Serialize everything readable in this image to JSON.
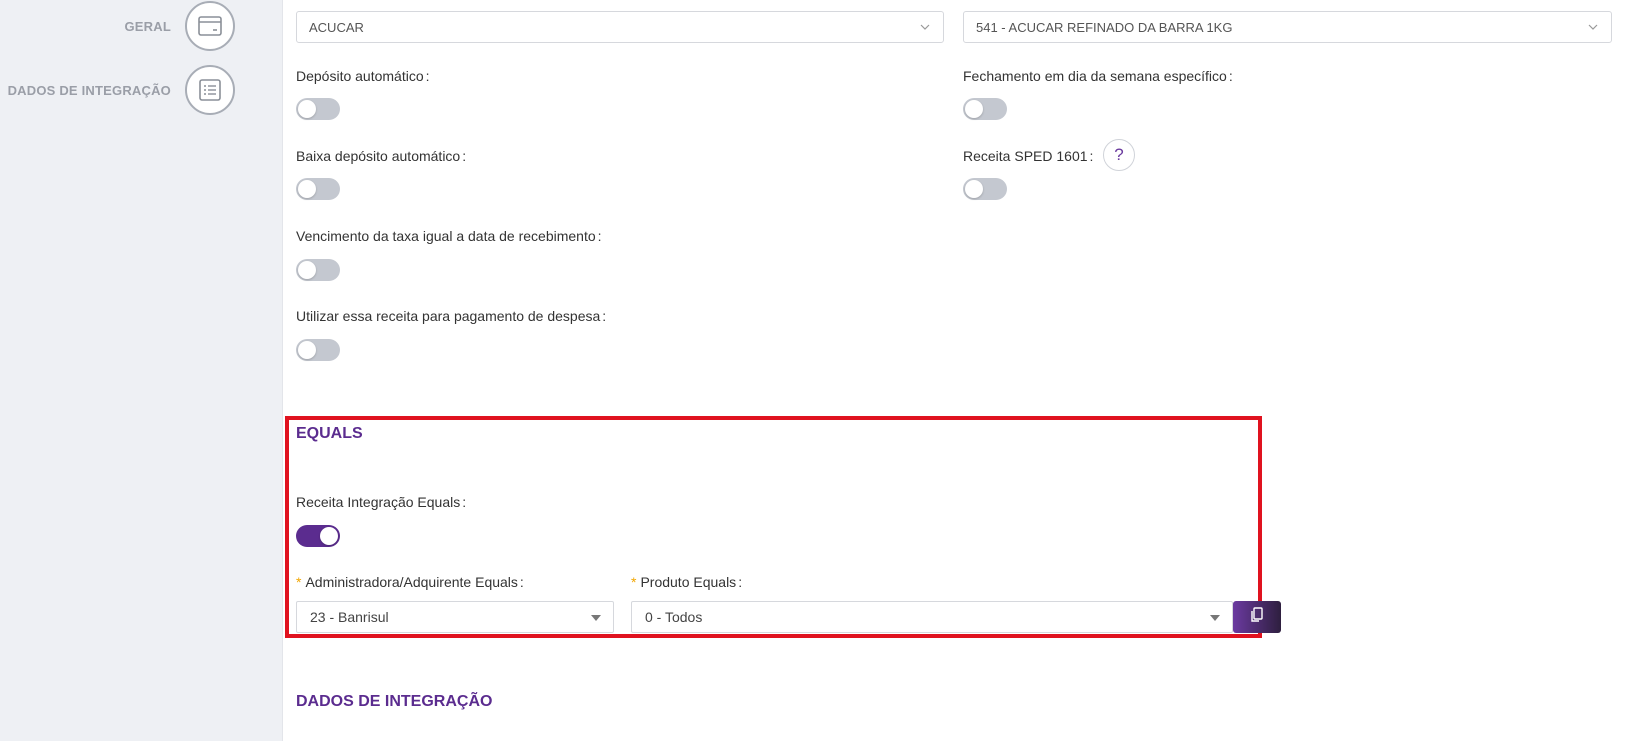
{
  "sidebar": {
    "items": [
      {
        "label": "GERAL",
        "icon": "card-icon"
      },
      {
        "label": "DADOS DE INTEGRAÇÃO",
        "icon": "list-icon"
      }
    ]
  },
  "selects": {
    "category": {
      "value": "ACUCAR"
    },
    "product": {
      "value": "541 - ACUCAR REFINADO DA BARRA 1KG"
    }
  },
  "toggles": {
    "deposito_automatico": {
      "label": "Depósito automático",
      "on": false
    },
    "fechamento_dia_semana": {
      "label": "Fechamento em dia da semana específico",
      "on": false
    },
    "baixa_deposito_automatico": {
      "label": "Baixa depósito automático",
      "on": false
    },
    "receita_sped": {
      "label": "Receita SPED 1601",
      "on": false
    },
    "vencimento_taxa": {
      "label": "Vencimento da taxa igual a data de recebimento",
      "on": false
    },
    "utilizar_receita": {
      "label": "Utilizar essa receita para pagamento de despesa",
      "on": false
    }
  },
  "help": {
    "symbol": "?"
  },
  "equals": {
    "title": "EQUALS",
    "receita_integracao": {
      "label": "Receita Integração Equals",
      "on": true
    },
    "administradora": {
      "required": "*",
      "label": "Administradora/Adquirente Equals",
      "value": "23 - Banrisul"
    },
    "produto": {
      "required": "*",
      "label": "Produto Equals",
      "value": "0 - Todos"
    }
  },
  "dados_integracao": {
    "title": "DADOS DE INTEGRAÇÃO"
  },
  "colors": {
    "accent": "#5b2c8f",
    "highlight": "#e0121f",
    "required": "#f2a600"
  }
}
